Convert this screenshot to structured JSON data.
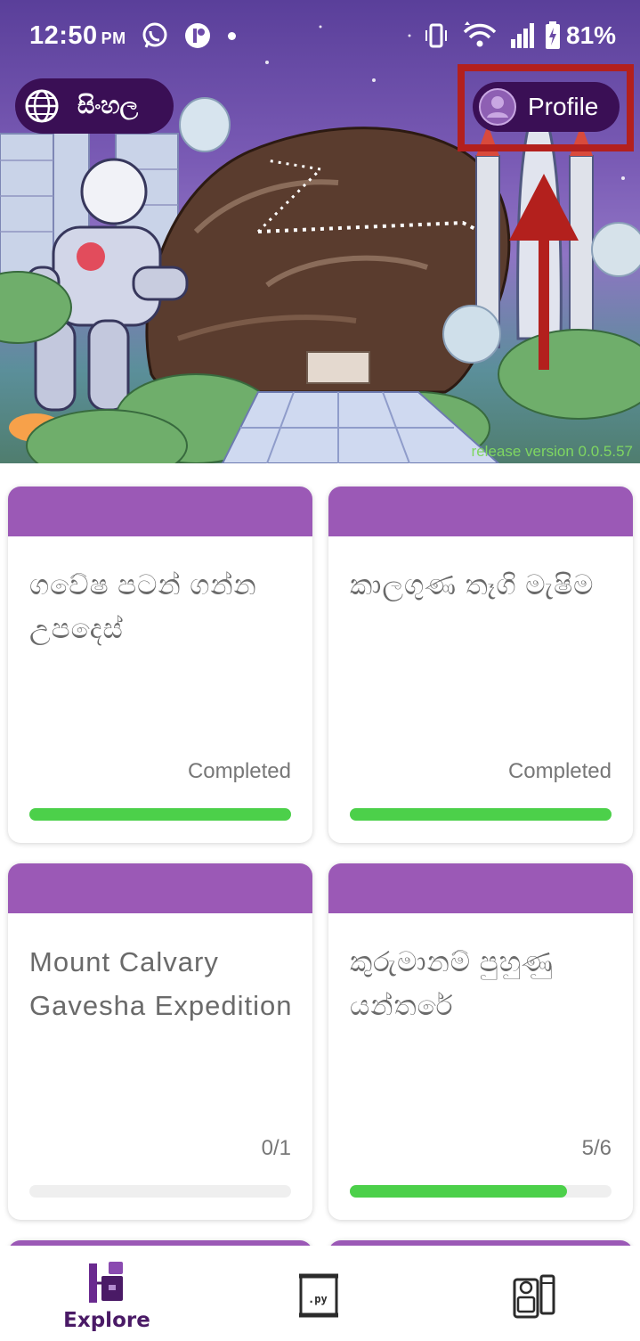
{
  "status_bar": {
    "time": "12:50",
    "ampm": "PM",
    "battery": "81%"
  },
  "header": {
    "language_button": "සිංහල",
    "profile_button": "Profile",
    "release": "release version 0.0.5.57"
  },
  "cards": [
    {
      "title": "ගවේෂ පටන් ගන්න උපදෙස්",
      "status": "Completed",
      "progress": 1.0
    },
    {
      "title": "කාලගුණ තෑගි මැෂිම",
      "status": "Completed",
      "progress": 1.0
    },
    {
      "title": "Mount Calvary Gavesha Expedition",
      "status": "0/1",
      "progress": 0.0
    },
    {
      "title": "කුරුමානම් පුහුණු යන්තරේ",
      "status": "5/6",
      "progress": 0.83
    }
  ],
  "bottom_nav": {
    "items": [
      {
        "label": "Explore",
        "icon": "explore-icon",
        "active": true
      },
      {
        "label": "",
        "icon": "python-file-icon",
        "active": false
      },
      {
        "label": "",
        "icon": "device-icon",
        "active": false
      }
    ]
  },
  "colors": {
    "card_band": "#9b59b6",
    "progress": "#4cd04a",
    "pill_bg": "#3a0f55",
    "highlight": "#b3201d"
  }
}
